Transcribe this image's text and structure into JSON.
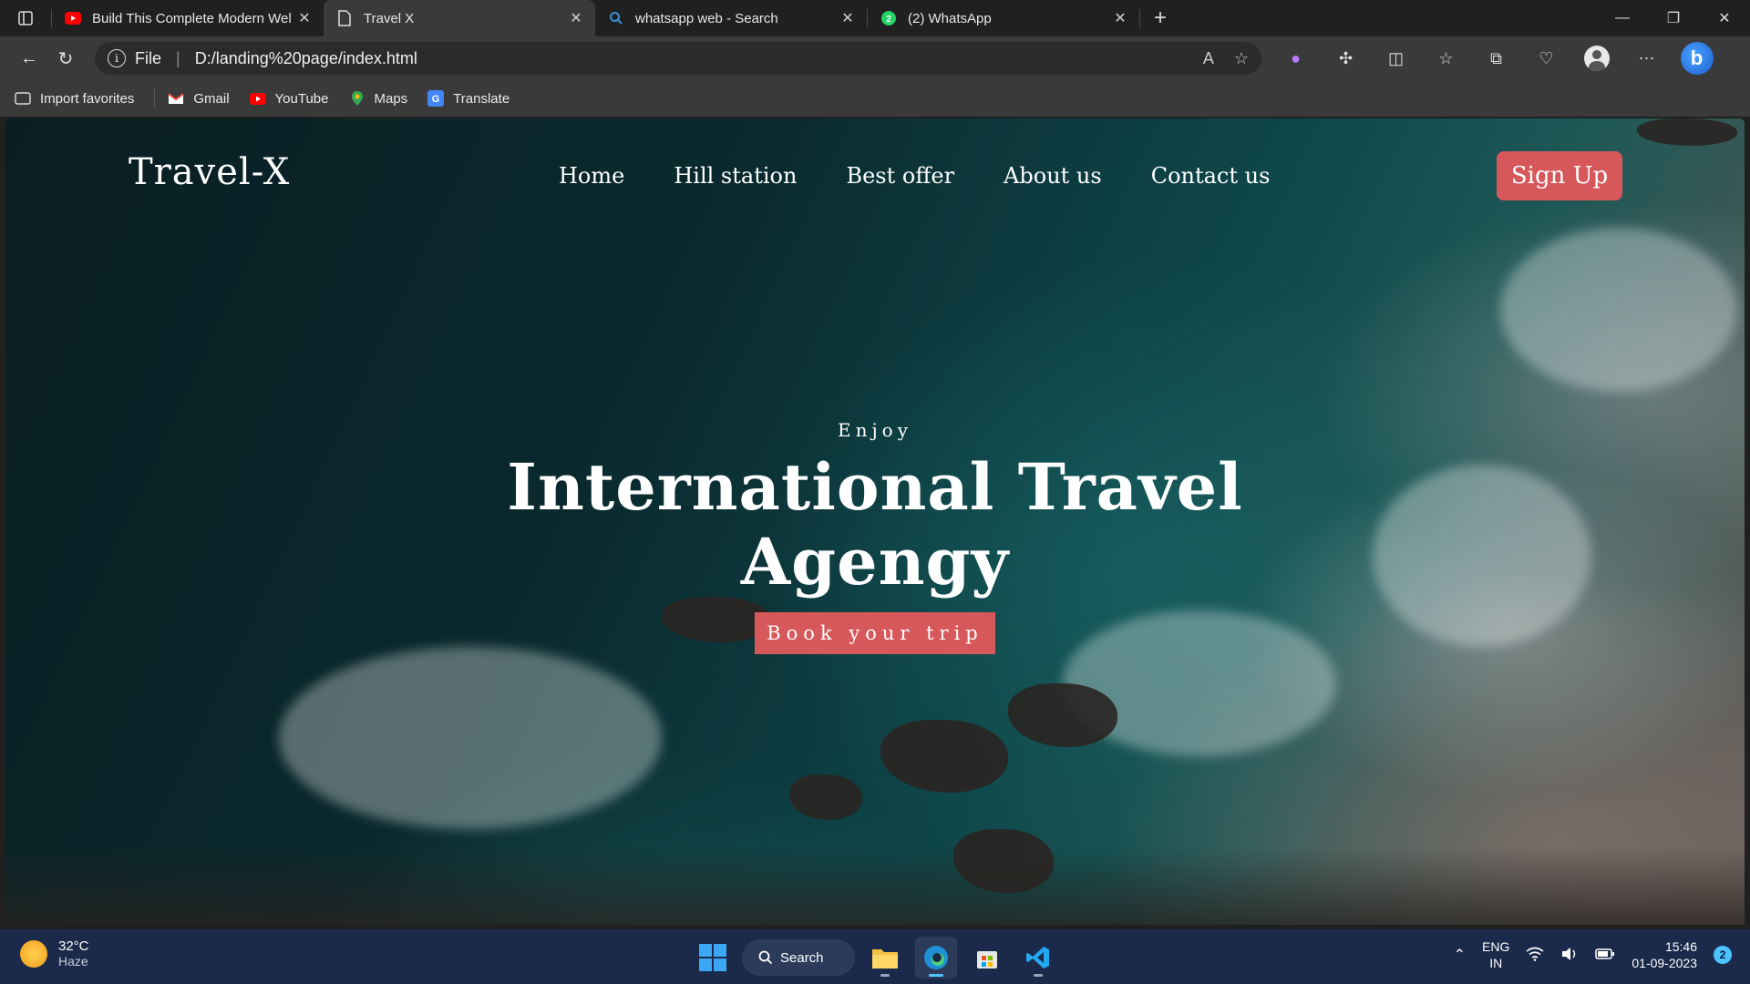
{
  "browser": {
    "tabs": [
      {
        "title": "Build This Complete Modern Wel",
        "icon": "youtube-icon"
      },
      {
        "title": "Travel X",
        "icon": "page-icon",
        "active": true
      },
      {
        "title": "whatsapp web - Search",
        "icon": "search-icon"
      },
      {
        "title": "(2) WhatsApp",
        "icon": "whatsapp-icon"
      }
    ],
    "address": {
      "scheme_label": "File",
      "url": "D:/landing%20page/index.html"
    },
    "favorites": [
      {
        "label": "Import favorites"
      },
      {
        "label": "Gmail"
      },
      {
        "label": "YouTube"
      },
      {
        "label": "Maps"
      },
      {
        "label": "Translate"
      }
    ]
  },
  "page": {
    "brand": "Travel-X",
    "nav": [
      "Home",
      "Hill station",
      "Best offer",
      "About us",
      "Contact us"
    ],
    "signup_label": "Sign Up",
    "hero": {
      "kicker": "Enjoy",
      "title_line1": "International Travel",
      "title_line2": "Agengy",
      "cta": "Book your trip"
    },
    "colors": {
      "accent": "#d6585b"
    }
  },
  "taskbar": {
    "weather": {
      "temp": "32°C",
      "condition": "Haze"
    },
    "search_label": "Search",
    "lang": {
      "line1": "ENG",
      "line2": "IN"
    },
    "time": "15:46",
    "date": "01-09-2023",
    "notifications": "2"
  }
}
